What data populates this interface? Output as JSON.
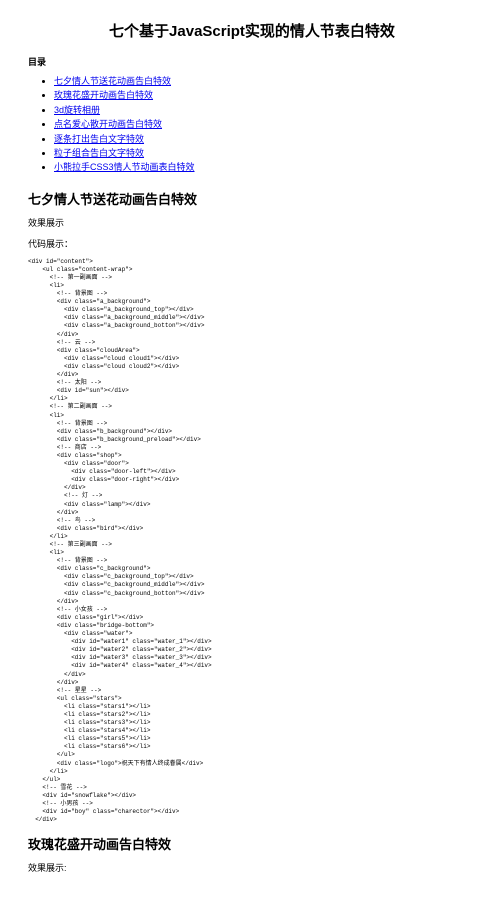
{
  "title": "七个基于JavaScript实现的情人节表白特效",
  "toc_label": "目录",
  "toc": [
    "七夕情人节送花动画告白特效",
    "玫瑰花盛开动画告白特效",
    "3d旋转相册",
    "点名爱心散开动画告白特效",
    "逐条打出告白文字特效",
    "粒子组合告白文字特效",
    "小熊拉手CSS3情人节动画表白特效"
  ],
  "section1": {
    "heading": "七夕情人节送花动画告白特效",
    "effect_label": "效果展示",
    "placeholder": "",
    "code_label": "代码展示："
  },
  "code1": "<div id=\"content\">\n    <ul class=\"content-wrap\">\n      <!-- 第一副画面 -->\n      <li>\n        <!-- 背景图 -->\n        <div class=\"a_background\">\n          <div class=\"a_background_top\"></div>\n          <div class=\"a_background_middle\"></div>\n          <div class=\"a_background_botton\"></div>\n        </div>\n        <!-- 云 -->\n        <div class=\"cloudArea\">\n          <div class=\"cloud cloud1\"></div>\n          <div class=\"cloud cloud2\"></div>\n        </div>\n        <!-- 太阳 -->\n        <div id=\"sun\"></div>\n      </li>\n      <!-- 第二副画面 -->\n      <li>\n        <!-- 背景图 -->\n        <div class=\"b_background\"></div>\n        <div class=\"b_background_preload\"></div>\n        <!-- 商店 -->\n        <div class=\"shop\">\n          <div class=\"door\">\n            <div class=\"door-left\"></div>\n            <div class=\"door-right\"></div>\n          </div>\n          <!-- 灯 -->\n          <div class=\"lamp\"></div>\n        </div>\n        <!-- 鸟 -->\n        <div class=\"bird\"></div>\n      </li>\n      <!-- 第三副画面 -->\n      <li>\n        <!-- 背景图 -->\n        <div class=\"c_background\">\n          <div class=\"c_background_top\"></div>\n          <div class=\"c_background_middle\"></div>\n          <div class=\"c_background_botton\"></div>\n        </div>\n        <!-- 小女孩 -->\n        <div class=\"girl\"></div>\n        <div class=\"bridge-bottom\">\n          <div class=\"water\">\n            <div id=\"water1\" class=\"water_1\"></div>\n            <div id=\"water2\" class=\"water_2\"></div>\n            <div id=\"water3\" class=\"water_3\"></div>\n            <div id=\"water4\" class=\"water_4\"></div>\n          </div>\n        </div>\n        <!-- 星星 -->\n        <ul class=\"stars\">\n          <li class=\"stars1\"></li>\n          <li class=\"stars2\"></li>\n          <li class=\"stars3\"></li>\n          <li class=\"stars4\"></li>\n          <li class=\"stars5\"></li>\n          <li class=\"stars6\"></li>\n        </ul>\n        <div class=\"logo\">祝天下有情人终成眷属</div>\n      </li>\n    </ul>\n    <!-- 雪花 -->\n    <div id=\"snowflake\"></div>\n    <!-- 小男孩 -->\n    <div id=\"boy\" class=\"charector\"></div>\n  </div>",
  "section2": {
    "heading": "玫瑰花盛开动画告白特效",
    "effect_label": "效果展示:",
    "placeholder": ""
  }
}
